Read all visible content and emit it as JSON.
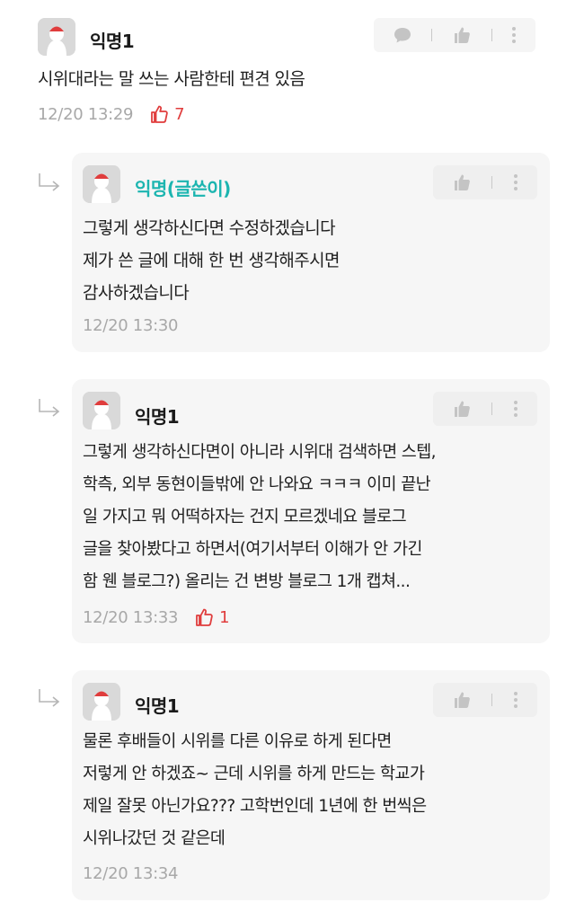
{
  "comments": [
    {
      "author": "익명1",
      "lines": [
        "시위대라는 말 쓰는 사람한테 편견 있음"
      ],
      "timestamp": "12/20 13:29",
      "votes": "7"
    },
    {
      "author": "익명(글쓴이)",
      "lines": [
        "그렇게 생각하신다면 수정하겠습니다",
        "제가 쓴 글에 대해 한 번 생각해주시면",
        "감사하겠습니다"
      ],
      "timestamp": "12/20 13:30"
    },
    {
      "author": "익명1",
      "lines": [
        "그렇게 생각하신다면이 아니라 시위대 검색하면 스텝,",
        "학측, 외부 동현이들밖에 안 나와요 ㅋㅋㅋ 이미 끝난",
        "일 가지고 뭐 어떡하자는 건지 모르겠네요 블로그",
        "글을 찾아봤다고 하면서(여기서부터 이해가 안 가긴",
        "함 웬 블로그?) 올리는 건 변방 블로그 1개 캡쳐..."
      ],
      "timestamp": "12/20 13:33",
      "votes": "1"
    },
    {
      "author": "익명1",
      "lines": [
        "물론 후배들이 시위를 다른 이유로 하게 된다면",
        "저렇게 안 하겠죠~ 근데 시위를 하게 만드는 학교가",
        "제일 잘못 아닌가요??? 고학번인데 1년에 한 번씩은",
        "시위나갔던 것 같은데"
      ],
      "timestamp": "12/20 13:34"
    }
  ],
  "icons": {
    "comment": "speech-bubble-icon",
    "like": "thumbs-up-icon",
    "more": "vertical-dots-icon",
    "reply": "reply-arrow-icon",
    "vote": "thumbs-up-outline-icon"
  },
  "colors": {
    "author_accent": "#1cb5b0",
    "vote": "#e03d3d",
    "card_bg": "#f6f6f6"
  }
}
